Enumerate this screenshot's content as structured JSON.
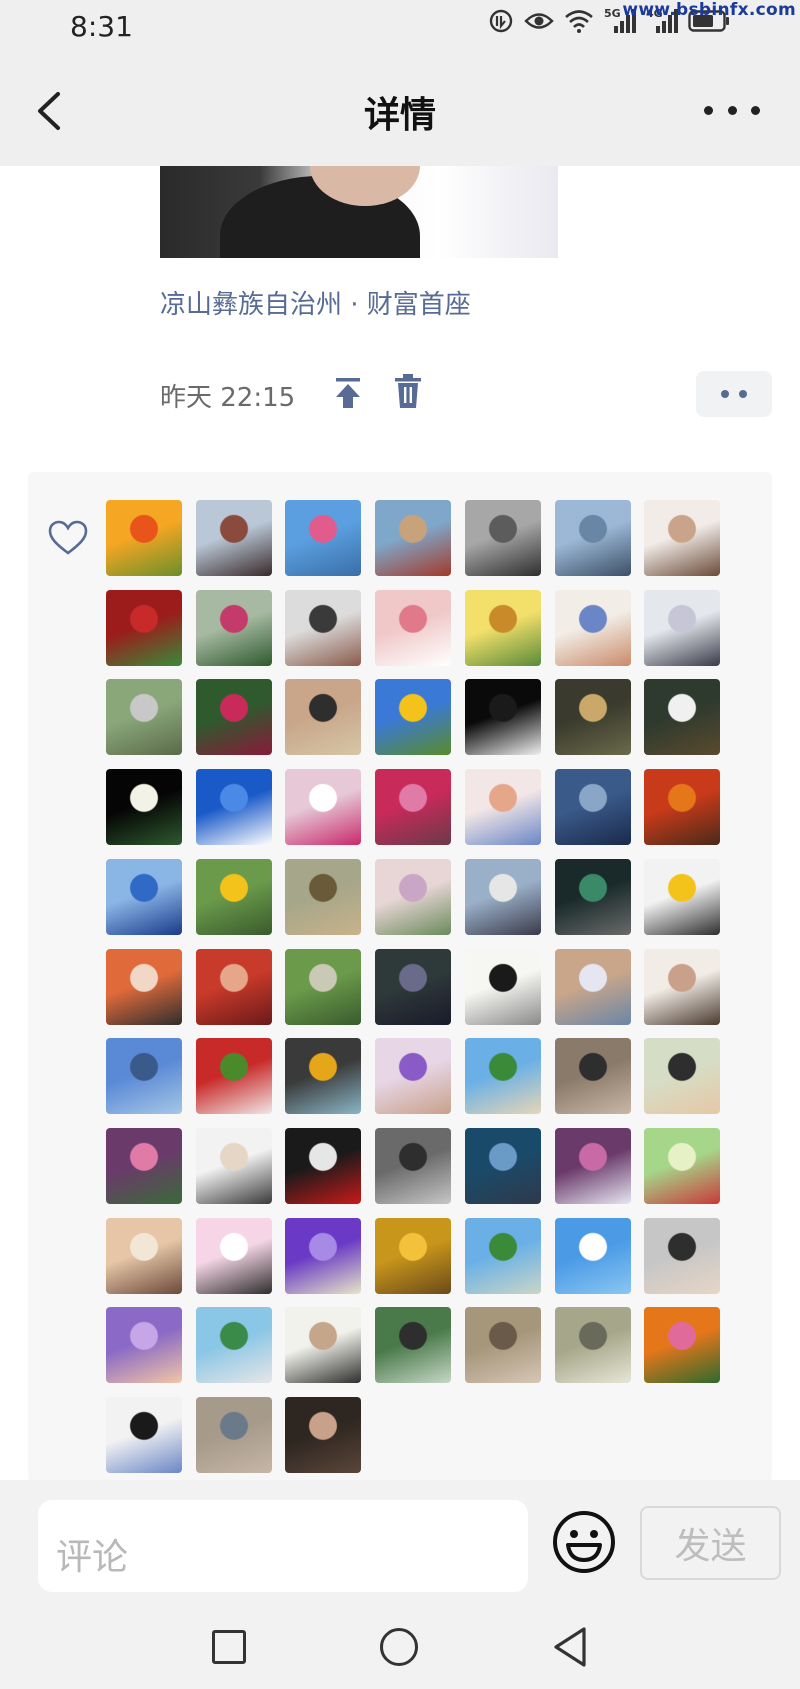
{
  "status_bar": {
    "time": "8:31",
    "network_5g": "5G",
    "network_4g": "4G",
    "watermark": "www.bsbinfx.com",
    "icons": [
      "nfc-icon",
      "eye-icon",
      "wifi-icon",
      "signal-icon",
      "signal-icon",
      "battery-icon"
    ]
  },
  "nav": {
    "title": "详情",
    "back_icon": "chevron-left-icon",
    "more_icon": "more-dots-icon"
  },
  "post": {
    "location": "凉山彝族自治州 · 财富首座",
    "time": "昨天 22:15",
    "action_icons": [
      "pin-to-top-icon",
      "delete-icon"
    ],
    "more_icon": "comment-dots-icon"
  },
  "likes": {
    "icon": "heart-outline-icon",
    "avatars": [
      {
        "name": "sunset-field",
        "colors": [
          "#f5a623",
          "#e8541a",
          "#6b8f2a"
        ]
      },
      {
        "name": "man-portrait",
        "colors": [
          "#b9c7d6",
          "#8a4a3c",
          "#3a2a2a"
        ]
      },
      {
        "name": "flower-bouquet",
        "colors": [
          "#5b9fe0",
          "#e25b8d",
          "#3a6ea8"
        ]
      },
      {
        "name": "lake-mountain-person",
        "colors": [
          "#7fa7c9",
          "#c8a27a",
          "#a23a2a"
        ]
      },
      {
        "name": "gray-figure",
        "colors": [
          "#a7a7a7",
          "#5c5c5c",
          "#2e2e2e"
        ]
      },
      {
        "name": "sea-horizon",
        "colors": [
          "#9cb8d6",
          "#6a86a6",
          "#3c4f66"
        ]
      },
      {
        "name": "woman-portrait",
        "colors": [
          "#f1ece8",
          "#c9a48a",
          "#6b4a38"
        ]
      },
      {
        "name": "red-seal-card",
        "colors": [
          "#9c1b1b",
          "#c82a2a",
          "#3a8a3a"
        ]
      },
      {
        "name": "red-flower-plant",
        "colors": [
          "#a7b9a2",
          "#c43a6a",
          "#2e5a2e"
        ]
      },
      {
        "name": "person-car",
        "colors": [
          "#dcdcdc",
          "#3a3a3a",
          "#8a5a4a"
        ]
      },
      {
        "name": "pink-roses",
        "colors": [
          "#f0c8c8",
          "#e07a8a",
          "#ffffff"
        ]
      },
      {
        "name": "sunflower-girl",
        "colors": [
          "#f3e06b",
          "#c98a2a",
          "#5a8a3a"
        ]
      },
      {
        "name": "baby-hat",
        "colors": [
          "#f2ede6",
          "#6a86c6",
          "#c98a6a"
        ]
      },
      {
        "name": "woman-blossom",
        "colors": [
          "#e4e8ec",
          "#c6c6d6",
          "#3a3a4a"
        ]
      },
      {
        "name": "person-rocks",
        "colors": [
          "#8aa77a",
          "#c8c8c8",
          "#5a6a4a"
        ]
      },
      {
        "name": "red-peony",
        "colors": [
          "#2e5a2e",
          "#c82a5a",
          "#8a1a3a"
        ]
      },
      {
        "name": "woman-bookshelf",
        "colors": [
          "#c9a68a",
          "#2e2e2e",
          "#d6c6a6"
        ]
      },
      {
        "name": "sunflower-sky",
        "colors": [
          "#3a7ad6",
          "#f3c21b",
          "#5a8a2a"
        ]
      },
      {
        "name": "dark-moon",
        "colors": [
          "#0a0a0a",
          "#1a1a1a",
          "#f0f0f0"
        ]
      },
      {
        "name": "man-glasses",
        "colors": [
          "#3a3a2e",
          "#c9a86a",
          "#6a6a4a"
        ]
      },
      {
        "name": "waterfall",
        "colors": [
          "#2e3a2e",
          "#f0f0f0",
          "#5a4a2e"
        ]
      },
      {
        "name": "white-flowers-dark",
        "colors": [
          "#050505",
          "#f2f2e6",
          "#2e5a2e"
        ]
      },
      {
        "name": "blue-sky-birds",
        "colors": [
          "#1a5ac8",
          "#4a8ae6",
          "#ffffff"
        ]
      },
      {
        "name": "woman-dog",
        "colors": [
          "#e6c8d6",
          "#ffffff",
          "#c82a6a"
        ]
      },
      {
        "name": "pink-bougainvillea",
        "colors": [
          "#c82a5a",
          "#e07aa6",
          "#6a3a4a"
        ]
      },
      {
        "name": "toddler-bear",
        "colors": [
          "#f2e6e6",
          "#e6a68a",
          "#6a86c6"
        ]
      },
      {
        "name": "moon-reflection",
        "colors": [
          "#3a5a8a",
          "#8aa6c6",
          "#1a2a4a"
        ]
      },
      {
        "name": "red-maple",
        "colors": [
          "#c83a1a",
          "#e6761a",
          "#4a2a1a"
        ]
      },
      {
        "name": "ocean-waves",
        "colors": [
          "#8ab6e6",
          "#2e6ac6",
          "#1a3a8a"
        ]
      },
      {
        "name": "yellow-field-mountain",
        "colors": [
          "#6a9a4a",
          "#f3c21b",
          "#3a5a2e"
        ]
      },
      {
        "name": "chickens-grass",
        "colors": [
          "#a6a68a",
          "#6a5a3a",
          "#c8b28a"
        ]
      },
      {
        "name": "woman-flowers",
        "colors": [
          "#e8d6d6",
          "#c9a6c6",
          "#6a8a5a"
        ]
      },
      {
        "name": "woman-sitting",
        "colors": [
          "#9ab0c8",
          "#e6e6e6",
          "#3a3a4a"
        ]
      },
      {
        "name": "green-dragon-statue",
        "colors": [
          "#1a2a2a",
          "#3a8a6a",
          "#6a6a6a"
        ]
      },
      {
        "name": "child-yellow-hat",
        "colors": [
          "#f2f2f2",
          "#f3c21b",
          "#2e2e2e"
        ]
      },
      {
        "name": "woman-orange-bg",
        "colors": [
          "#e06a3a",
          "#f2d6c6",
          "#2e2e2e"
        ]
      },
      {
        "name": "red-apples",
        "colors": [
          "#c83a2a",
          "#e6a68a",
          "#6a1a1a"
        ]
      },
      {
        "name": "garden-path",
        "colors": [
          "#6a9a4a",
          "#c9c9b6",
          "#3a5a2e"
        ]
      },
      {
        "name": "man-dark-room",
        "colors": [
          "#2e3a3a",
          "#6a6a8a",
          "#1a1a2a"
        ]
      },
      {
        "name": "ink-dragon",
        "colors": [
          "#f6f6f2",
          "#1a1a1a",
          "#8a8a8a"
        ]
      },
      {
        "name": "white-cat-art",
        "colors": [
          "#c9a68a",
          "#e6e6f2",
          "#6a86a6"
        ]
      },
      {
        "name": "woman-portrait-2",
        "colors": [
          "#f2ece6",
          "#c9a08a",
          "#4a3a2e"
        ]
      },
      {
        "name": "city-waterfront",
        "colors": [
          "#5a8ad6",
          "#3a5a8a",
          "#a6c6e6"
        ]
      },
      {
        "name": "cherries",
        "colors": [
          "#c82a2a",
          "#4a8a2a",
          "#f2e6e6"
        ]
      },
      {
        "name": "food-jar",
        "colors": [
          "#3a3a3a",
          "#e6a61a",
          "#8ab6c6"
        ]
      },
      {
        "name": "woman-purple-bag",
        "colors": [
          "#e6d6e6",
          "#8a5ac6",
          "#c9a08a"
        ]
      },
      {
        "name": "beach-tree-child",
        "colors": [
          "#6ab0e6",
          "#3a8a3a",
          "#e6d6b6"
        ]
      },
      {
        "name": "woman-stone-wall",
        "colors": [
          "#8a7a6a",
          "#2e2e2e",
          "#c9b6a6"
        ]
      },
      {
        "name": "kid-sunglasses",
        "colors": [
          "#d6ddc6",
          "#2e2e2e",
          "#e6c8a6"
        ]
      },
      {
        "name": "flower-arch",
        "colors": [
          "#6a3a6a",
          "#e07aa6",
          "#3a6a3a"
        ]
      },
      {
        "name": "woman-white-coat",
        "colors": [
          "#f2f2f2",
          "#e6d6c6",
          "#3a3a3a"
        ]
      },
      {
        "name": "woman-red-rose",
        "colors": [
          "#1a1a1a",
          "#e6e6e6",
          "#c81a1a"
        ]
      },
      {
        "name": "building-street",
        "colors": [
          "#6a6a6a",
          "#2e2e2e",
          "#c6c6c6"
        ]
      },
      {
        "name": "blue-hydrangea",
        "colors": [
          "#1a4a6a",
          "#6a9ac6",
          "#2e3a4a"
        ]
      },
      {
        "name": "purple-tree",
        "colors": [
          "#6a3a6a",
          "#c86aa6",
          "#e6e6f2"
        ]
      },
      {
        "name": "gratitude-card",
        "colors": [
          "#a6d68a",
          "#e6f2c6",
          "#c83a3a"
        ]
      },
      {
        "name": "two-women",
        "colors": [
          "#e6c6a6",
          "#f2e6d6",
          "#6a4a3a"
        ]
      },
      {
        "name": "cartoon-smile",
        "colors": [
          "#f6d6e6",
          "#ffffff",
          "#2e2e2e"
        ]
      },
      {
        "name": "purple-crocus",
        "colors": [
          "#6a3ac6",
          "#a68ae6",
          "#e6e6c6"
        ]
      },
      {
        "name": "yellow-ginkgo",
        "colors": [
          "#c8961a",
          "#f3c23a",
          "#6a4a1a"
        ]
      },
      {
        "name": "mountain-lake",
        "colors": [
          "#6ab0e6",
          "#3a8a3a",
          "#c9d6c6"
        ]
      },
      {
        "name": "smiling-cloud",
        "colors": [
          "#4a9ae6",
          "#ffffff",
          "#8ac6f2"
        ]
      },
      {
        "name": "man-in-car",
        "colors": [
          "#c6c6c6",
          "#2e2e2e",
          "#e6d6c6"
        ]
      },
      {
        "name": "lavender-field",
        "colors": [
          "#8a6ac6",
          "#c6a6e6",
          "#f2c6a6"
        ]
      },
      {
        "name": "palace-gardens",
        "colors": [
          "#8ac6e6",
          "#3a8a4a",
          "#e6e6e6"
        ]
      },
      {
        "name": "cartoon-baby",
        "colors": [
          "#f2f2ec",
          "#c6a68a",
          "#2e2e2e"
        ]
      },
      {
        "name": "family-trees",
        "colors": [
          "#4a7a4a",
          "#2e2e2e",
          "#c6d6c6"
        ]
      },
      {
        "name": "rocky-dog",
        "colors": [
          "#a6967a",
          "#6a5a4a",
          "#d6c6b6"
        ]
      },
      {
        "name": "man-cap-forest",
        "colors": [
          "#a6a68a",
          "#6a6a5a",
          "#e6e6d6"
        ]
      },
      {
        "name": "pink-cake",
        "colors": [
          "#e6761a",
          "#e06a9a",
          "#2e6a2e"
        ]
      },
      {
        "name": "cartoon-girl",
        "colors": [
          "#f2f2f2",
          "#1a1a1a",
          "#6a86c6"
        ]
      },
      {
        "name": "river-valley",
        "colors": [
          "#a69a8a",
          "#6a7a8a",
          "#c6b6a6"
        ]
      },
      {
        "name": "woman-dark-hair",
        "colors": [
          "#2e2620",
          "#c9a08a",
          "#5a463a"
        ]
      }
    ]
  },
  "comment": {
    "placeholder": "评论",
    "emoji_icon": "smiley-icon",
    "send_label": "发送"
  },
  "system_nav": {
    "recents_icon": "square-icon",
    "home_icon": "circle-icon",
    "back_icon": "triangle-back-icon"
  }
}
